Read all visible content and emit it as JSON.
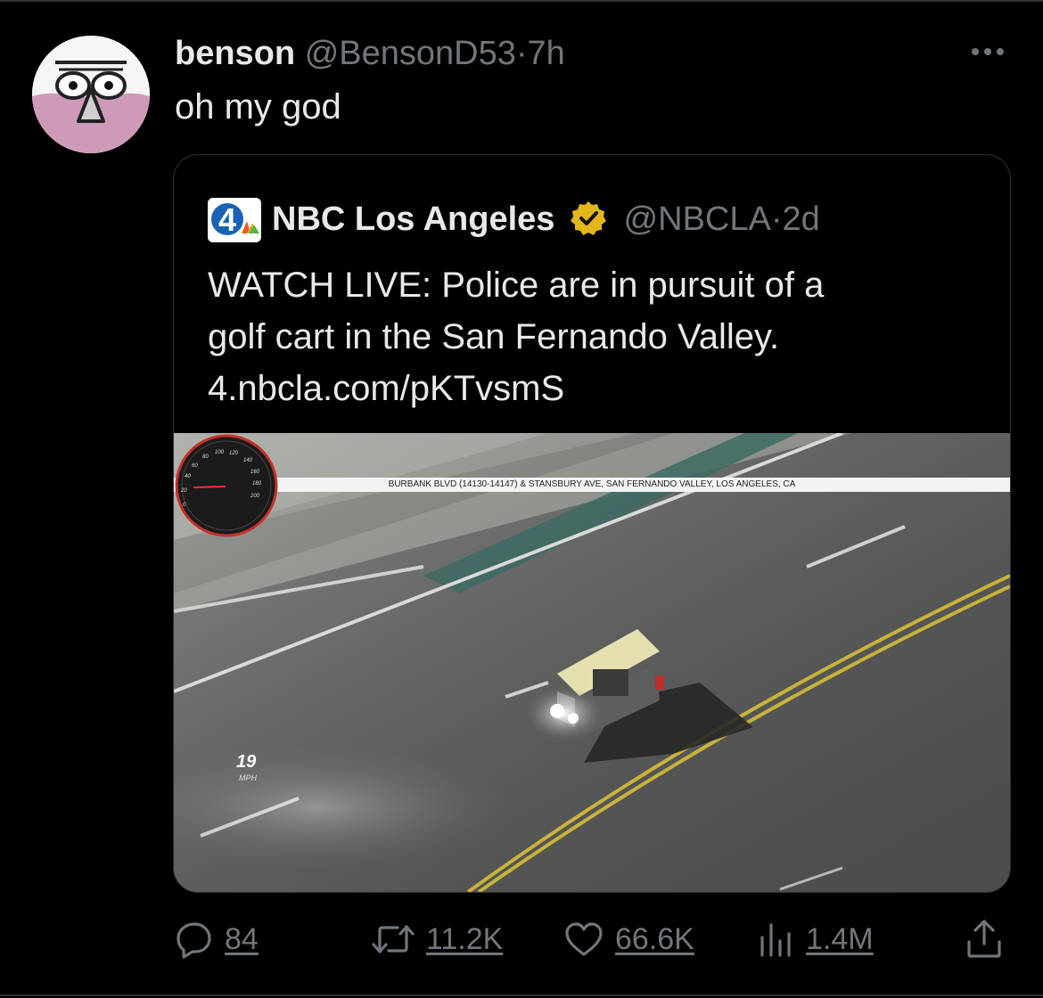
{
  "tweet": {
    "display_name": "benson",
    "handle": "@BensonD53",
    "separator": "·",
    "time": "7h",
    "text": "oh my god"
  },
  "quoted": {
    "display_name": "NBC Los Angeles",
    "handle": "@NBCLA",
    "separator": "·",
    "time": "2d",
    "text_lines": [
      "WATCH LIVE: Police are in pursuit of a",
      "golf cart in the San Fernando Valley.",
      "4.nbcla.com/pKTvsmS"
    ],
    "logo_text": "4",
    "media": {
      "location_bar": "BURBANK BLVD (14130-14147) & STANSBURY AVE, SAN FERNANDO VALLEY, LOS ANGELES, CA",
      "speed_value": "19",
      "speed_unit": "MPH",
      "speedometer_ticks": [
        "0",
        "20",
        "40",
        "60",
        "80",
        "100",
        "120",
        "140",
        "160",
        "180",
        "200"
      ]
    }
  },
  "actions": {
    "replies": "84",
    "retweets": "11.2K",
    "likes": "66.6K",
    "views": "1.4M"
  },
  "icons": {
    "more": "more-icon",
    "reply": "reply-icon",
    "retweet": "retweet-icon",
    "like": "heart-icon",
    "views": "views-icon",
    "share": "share-icon",
    "verified": "verified-badge-icon"
  },
  "colors": {
    "background": "#000000",
    "text_primary": "#e7e9ea",
    "text_secondary": "#71767b",
    "border": "#2f3336",
    "verified_gold": "#e2b719",
    "nbc_blue": "#1a62b4"
  }
}
